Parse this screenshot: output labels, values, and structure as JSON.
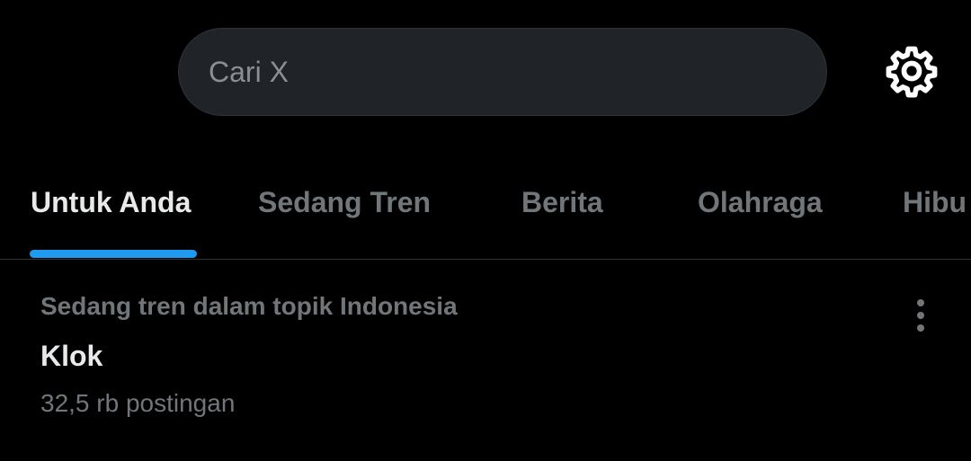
{
  "search": {
    "placeholder": "Cari X"
  },
  "settings": {
    "icon": "gear-icon"
  },
  "tabs": [
    {
      "label": "Untuk Anda",
      "active": true
    },
    {
      "label": "Sedang Tren",
      "active": false
    },
    {
      "label": "Berita",
      "active": false
    },
    {
      "label": "Olahraga",
      "active": false
    },
    {
      "label": "Hibu",
      "active": false
    }
  ],
  "trend": {
    "context": "Sedang tren dalam topik Indonesia",
    "title": "Klok",
    "count": "32,5 rb postingan",
    "more_icon": "more-vertical-icon"
  },
  "colors": {
    "background": "#000000",
    "search_bg": "#202327",
    "accent": "#1d9bf0",
    "primary_text": "#e7e9ea",
    "secondary_text": "#71767b",
    "divider": "#2f3336"
  }
}
